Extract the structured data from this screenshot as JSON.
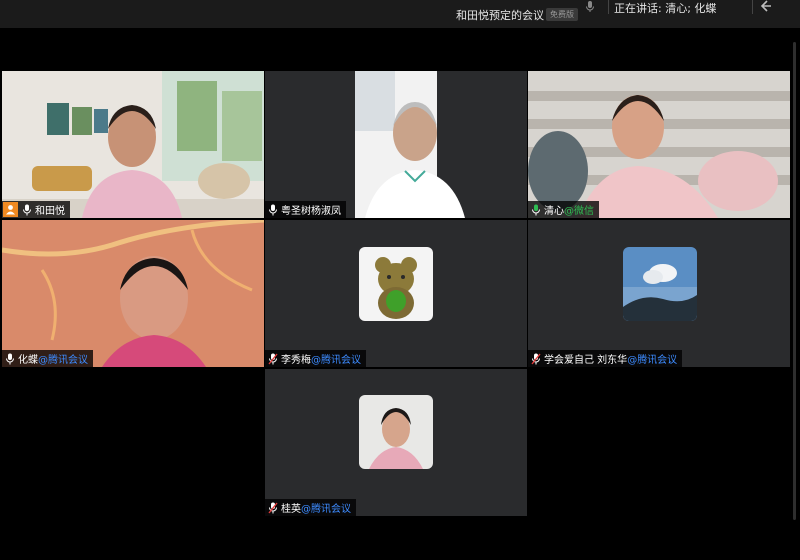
{
  "meeting": {
    "title": "和田悦预定的会议",
    "badge": "免费版",
    "speaking": "正在讲话: 清心; 化蝶"
  },
  "participants": [
    {
      "name": "和田悦",
      "suffix": "",
      "host": true
    },
    {
      "name": "粤圣树杨淑凤",
      "suffix": "",
      "host": false
    },
    {
      "name": "清心",
      "suffix": "@微信",
      "host": false
    },
    {
      "name": "化蝶",
      "suffix": "@腾讯会议",
      "host": false
    },
    {
      "name": "李秀梅",
      "suffix": "@腾讯会议",
      "host": false
    },
    {
      "name": "学会爱自己 刘东华",
      "suffix": "@腾讯会议",
      "host": false
    },
    {
      "name": "桂英",
      "suffix": "@腾讯会议",
      "host": false
    }
  ],
  "colors": {
    "active_border": "#2fae5f",
    "suffix_blue": "#3d8bff",
    "suffix_green": "#2fbd52",
    "host_badge": "#f08a22"
  },
  "icons": [
    "microphone-icon",
    "host-icon",
    "exit-icon"
  ]
}
